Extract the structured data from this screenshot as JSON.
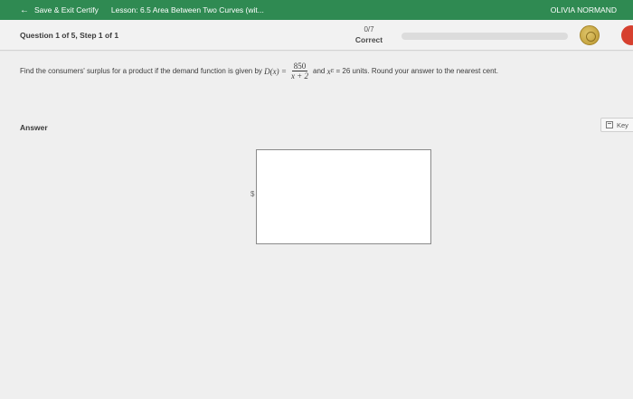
{
  "topbar": {
    "save_exit": "Save & Exit Certify",
    "lesson": "Lesson: 6.5 Area Between Two Curves (wit...",
    "user": "OLIVIA NORMAND"
  },
  "question_header": {
    "title": "Question 1 of 5, Step 1 of 1",
    "score_fraction": "0/7",
    "score_label": "Correct",
    "progress_percent": 0
  },
  "question": {
    "prefix": "Find the consumers' surplus for a product if the demand function is given by",
    "func": "D(x) =",
    "numerator": "850",
    "denominator": "x + 2",
    "middle": "and",
    "xe": "x",
    "xe_sub": "E",
    "xe_value": "= 26 units. Round your answer to the nearest cent."
  },
  "answer": {
    "label": "Answer",
    "currency": "$",
    "value": ""
  },
  "keypad": {
    "label": "Key"
  }
}
